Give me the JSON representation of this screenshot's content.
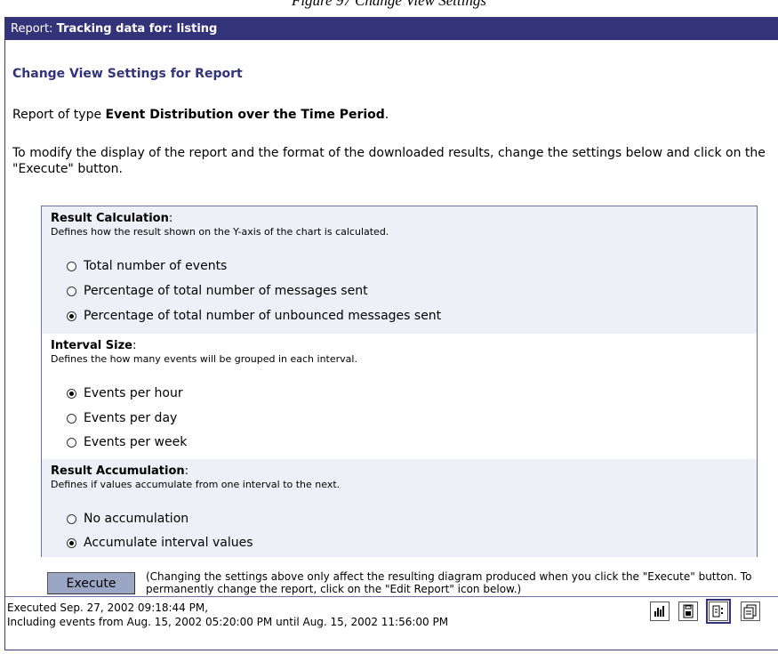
{
  "caption": "Figure 97 Change View Settings",
  "header": {
    "label": "Report:",
    "title": "Tracking data for: listing"
  },
  "section_title": "Change View Settings for Report",
  "type_line": {
    "prefix": "Report of type",
    "type": "Event Distribution over the Time Period",
    "suffix": "."
  },
  "instructions": "To modify the display of the report and the format of the downloaded results, change the settings below and click on the \"Execute\" button.",
  "groups": {
    "result_calculation": {
      "title": "Result Calculation",
      "description": "Defines how the result shown on the Y-axis of the chart is calculated.",
      "options": [
        {
          "label": "Total number of events",
          "selected": false
        },
        {
          "label": "Percentage of total number of messages sent",
          "selected": false
        },
        {
          "label": "Percentage of total number of unbounced messages sent",
          "selected": true
        }
      ]
    },
    "interval_size": {
      "title": "Interval Size",
      "description": "Defines the how many events will be grouped in each interval.",
      "options": [
        {
          "label": "Events per hour",
          "selected": true
        },
        {
          "label": "Events per day",
          "selected": false
        },
        {
          "label": "Events per week",
          "selected": false
        }
      ]
    },
    "result_accumulation": {
      "title": "Result Accumulation",
      "description": "Defines if values accumulate from one interval to the next.",
      "options": [
        {
          "label": "No accumulation",
          "selected": false
        },
        {
          "label": "Accumulate interval values",
          "selected": true
        }
      ]
    }
  },
  "execute": {
    "label": "Execute",
    "note": "(Changing the settings above only affect the resulting diagram produced when you click the \"Execute\" button. To permanently change the report, click on the \"Edit Report\" icon below.)"
  },
  "footer": {
    "executed": "Executed Sep. 27, 2002 09:18:44 PM,",
    "range": "Including events from Aug. 15, 2002 05:20:00 PM until Aug. 15, 2002 11:56:00 PM"
  },
  "toolbar_icons": [
    "bar-chart-icon",
    "save-download-icon",
    "view-settings-icon",
    "copy-report-icon"
  ]
}
